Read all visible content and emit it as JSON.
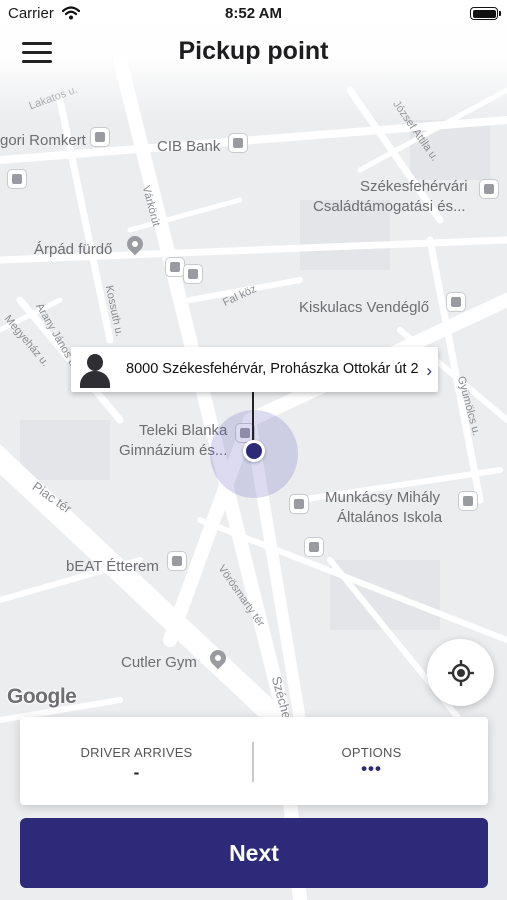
{
  "status_bar": {
    "carrier": "Carrier",
    "time": "8:52 AM",
    "wifi_icon": "wifi-icon",
    "battery_icon": "battery-icon"
  },
  "header": {
    "title": "Pickup point",
    "menu_icon": "hamburger-menu-icon"
  },
  "map": {
    "places": {
      "romkert": "gori Romkert",
      "cib_bank": "CIB Bank",
      "csalad_line1": "Székesfehérvári",
      "csalad_line2": "Családtámogatási és...",
      "arpad": "Árpád fürdő",
      "kiskulacs": "Kiskulacs Vendéglő",
      "teleki_line1": "Teleki Blanka",
      "teleki_line2": "Gimnázium és...",
      "munkacsy_line1": "Munkácsy Mihály",
      "munkacsy_line2": "Általános Iskola",
      "beat": "bEAT Étterem",
      "cutler": "Cutler Gym"
    },
    "streets": {
      "lakatos": "Lakatos u.",
      "jozsef": "József Attila u.",
      "varkorut": "Várkörút",
      "fal_koz": "Fal köz",
      "kossuth": "Kossuth u.",
      "arany": "Arany János u.",
      "megyehaz": "Megyeház u.",
      "piac_ter": "Piac tér",
      "gyumolcs": "Gyümölcs u.",
      "vorosmarty": "Vörösmarty tér",
      "szeche": "Széche"
    },
    "google_logo": "Google"
  },
  "pickup": {
    "address": "8000 Székesfehérvár, Prohászka Ottokár út 2",
    "avatar_icon": "person-icon",
    "chevron_icon": "chevron-right-icon"
  },
  "controls": {
    "locate_icon": "crosshair-location-icon"
  },
  "info": {
    "driver_arrives_label": "DRIVER ARRIVES",
    "driver_arrives_value": "-",
    "options_label": "OPTIONS",
    "options_value": "•••"
  },
  "actions": {
    "next_label": "Next"
  },
  "colors": {
    "accent": "#2d2a7a",
    "map_background": "#ecedef",
    "road": "#ffffff"
  }
}
